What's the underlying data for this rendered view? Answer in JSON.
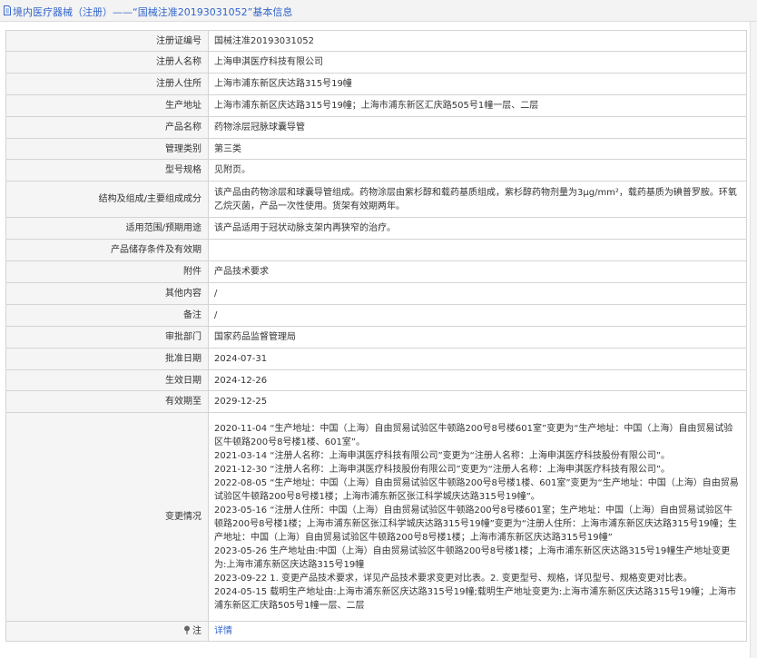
{
  "header": {
    "title": "境内医疗器械（注册）——“国械注准20193031052”基本信息"
  },
  "rows": [
    {
      "label": "注册证编号",
      "value": "国械注准20193031052"
    },
    {
      "label": "注册人名称",
      "value": "上海申淇医疗科技有限公司"
    },
    {
      "label": "注册人住所",
      "value": "上海市浦东新区庆达路315号19幢"
    },
    {
      "label": "生产地址",
      "value": "上海市浦东新区庆达路315号19幢；上海市浦东新区汇庆路505号1幢一层、二层"
    },
    {
      "label": "产品名称",
      "value": "药物涂层冠脉球囊导管"
    },
    {
      "label": "管理类别",
      "value": "第三类"
    },
    {
      "label": "型号规格",
      "value": "见附页。"
    },
    {
      "label": "结构及组成/主要组成成分",
      "value": "该产品由药物涂层和球囊导管组成。药物涂层由紫杉醇和载药基质组成，紫杉醇药物剂量为3μg/mm²，载药基质为碘普罗胺。环氧乙烷灭菌，产品一次性使用。货架有效期两年。"
    },
    {
      "label": "适用范围/预期用途",
      "value": "该产品适用于冠状动脉支架内再狭窄的治疗。"
    },
    {
      "label": "产品储存条件及有效期",
      "value": ""
    },
    {
      "label": "附件",
      "value": "产品技术要求"
    },
    {
      "label": "其他内容",
      "value": "/"
    },
    {
      "label": "备注",
      "value": "/"
    },
    {
      "label": "审批部门",
      "value": "国家药品监督管理局"
    },
    {
      "label": "批准日期",
      "value": "2024-07-31"
    },
    {
      "label": "生效日期",
      "value": "2024-12-26"
    },
    {
      "label": "有效期至",
      "value": "2029-12-25"
    }
  ],
  "changes": {
    "label": "变更情况",
    "entries": [
      "2020-11-04 “生产地址：中国（上海）自由贸易试验区牛顿路200号8号楼601室”变更为“生产地址：中国（上海）自由贸易试验区牛顿路200号8号楼1楼、601室”。",
      "2021-03-14 “注册人名称：上海申淇医疗科技有限公司”变更为“注册人名称：上海申淇医疗科技股份有限公司”。",
      "2021-12-30 “注册人名称：上海申淇医疗科技股份有限公司”变更为“注册人名称：上海申淇医疗科技有限公司”。",
      "2022-08-05 “生产地址：中国（上海）自由贸易试验区牛顿路200号8号楼1楼、601室”变更为“生产地址：中国（上海）自由贸易试验区牛顿路200号8号楼1楼；上海市浦东新区张江科学城庆达路315号19幢”。",
      "2023-05-16 “注册人住所：中国（上海）自由贸易试验区牛顿路200号8号楼601室；生产地址：中国（上海）自由贸易试验区牛顿路200号8号楼1楼；上海市浦东新区张江科学城庆达路315号19幢”变更为“注册人住所：上海市浦东新区庆达路315号19幢；生产地址：中国（上海）自由贸易试验区牛顿路200号8号楼1楼；上海市浦东新区庆达路315号19幢”",
      "2023-05-26 生产地址由:中国（上海）自由贸易试验区牛顿路200号8号楼1楼；上海市浦东新区庆达路315号19幢生产地址变更为:上海市浦东新区庆达路315号19幢",
      "2023-09-22 1. 变更产品技术要求，详见产品技术要求变更对比表。2. 变更型号、规格，详见型号、规格变更对比表。",
      "2024-05-15 载明生产地址由:上海市浦东新区庆达路315号19幢;载明生产地址变更为:上海市浦东新区庆达路315号19幢；上海市浦东新区汇庆路505号1幢一层、二层"
    ]
  },
  "note": {
    "label": "注",
    "link_text": "详情"
  },
  "icons": [
    "document-icon",
    "note-pin-icon"
  ],
  "colors": {
    "link": "#3366cc",
    "label_bg": "#f5f5f5",
    "border": "#d4d4d4"
  }
}
